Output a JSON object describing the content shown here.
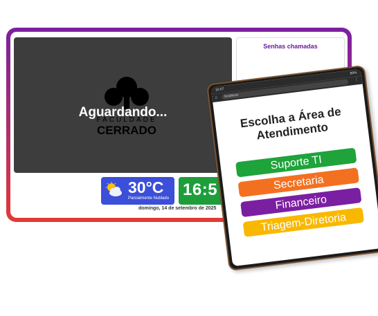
{
  "tv": {
    "status_text": "Aguardando...",
    "logo_text_top": "FACULDADE",
    "logo_text_bottom": "CERRADO",
    "called_title": "Senhas chamadas",
    "weather": {
      "temp": "30°C",
      "condition": "Parcialmente Nublado",
      "icon": "partly-cloudy-icon"
    },
    "clock": {
      "time": "16:5"
    },
    "date": "domingo, 14 de setembro de 2025"
  },
  "tablet": {
    "status_left": "16:07",
    "status_right": "89%",
    "url": "localhost",
    "heading": "Escolha a Área de Atendimento",
    "options": [
      "Suporte TI",
      "Secretaria",
      "Financeiro",
      "Triagem-Diretoria"
    ]
  },
  "colors": {
    "frame_gradient": [
      "#7b1fa2",
      "#e53935"
    ],
    "weather_bg": "#3b4fd8",
    "clock_bg": "#1e9e3b",
    "option_colors": [
      "#1fa33b",
      "#f37021",
      "#7b1fa2",
      "#f9b800"
    ]
  }
}
